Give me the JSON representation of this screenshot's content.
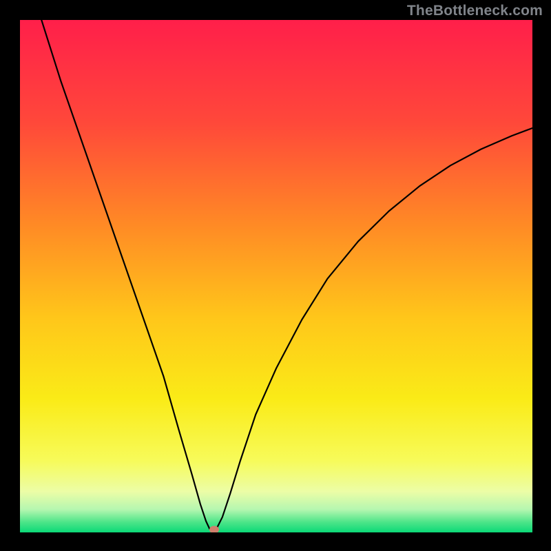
{
  "watermark": "TheBottleneck.com",
  "chart_data": {
    "type": "line",
    "title": "",
    "xlabel": "",
    "ylabel": "",
    "xlim": [
      0,
      100
    ],
    "ylim": [
      0,
      100
    ],
    "grid": false,
    "legend": false,
    "gradient_stops": [
      {
        "offset": 0.0,
        "color": "#ff1f4a"
      },
      {
        "offset": 0.2,
        "color": "#ff483a"
      },
      {
        "offset": 0.4,
        "color": "#ff8a25"
      },
      {
        "offset": 0.58,
        "color": "#ffc61a"
      },
      {
        "offset": 0.74,
        "color": "#faeb17"
      },
      {
        "offset": 0.86,
        "color": "#f7fb5a"
      },
      {
        "offset": 0.92,
        "color": "#ecfda6"
      },
      {
        "offset": 0.955,
        "color": "#b6f7b0"
      },
      {
        "offset": 0.98,
        "color": "#4de589"
      },
      {
        "offset": 1.0,
        "color": "#0bd977"
      }
    ],
    "series": [
      {
        "name": "bottleneck-curve",
        "color": "#000000",
        "x": [
          4.2,
          8,
          12,
          16,
          20,
          24,
          28,
          31,
          33.5,
          35.2,
          36.3,
          37.0,
          37.7,
          38.5,
          39.5,
          41,
          43,
          46,
          50,
          55,
          60,
          66,
          72,
          78,
          84,
          90,
          96,
          100
        ],
        "y": [
          100,
          88,
          76.5,
          65,
          53.5,
          42,
          30.5,
          20,
          11.5,
          5.5,
          2.2,
          0.7,
          0.5,
          1.0,
          3.0,
          7.5,
          14,
          23,
          32,
          41.5,
          49.5,
          56.8,
          62.7,
          67.6,
          71.6,
          74.8,
          77.4,
          78.9
        ]
      }
    ],
    "marker": {
      "x": 37.9,
      "y": 0.5,
      "color": "#cf7f6c"
    }
  }
}
